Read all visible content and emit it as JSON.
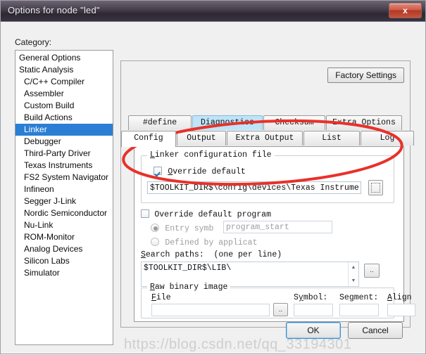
{
  "window": {
    "title": "Options for node \"led\"",
    "close_label": "x"
  },
  "category": {
    "label": "Category:",
    "items": [
      {
        "label": "General Options",
        "indent": false,
        "selected": false
      },
      {
        "label": "Static Analysis",
        "indent": false,
        "selected": false
      },
      {
        "label": "C/C++ Compiler",
        "indent": true,
        "selected": false
      },
      {
        "label": "Assembler",
        "indent": true,
        "selected": false
      },
      {
        "label": "Custom Build",
        "indent": true,
        "selected": false
      },
      {
        "label": "Build Actions",
        "indent": true,
        "selected": false
      },
      {
        "label": "Linker",
        "indent": true,
        "selected": true
      },
      {
        "label": "Debugger",
        "indent": true,
        "selected": false
      },
      {
        "label": "Third-Party Driver",
        "indent": true,
        "selected": false
      },
      {
        "label": "Texas Instruments",
        "indent": true,
        "selected": false
      },
      {
        "label": "FS2 System Navigator",
        "indent": true,
        "selected": false
      },
      {
        "label": "Infineon",
        "indent": true,
        "selected": false
      },
      {
        "label": "Segger J-Link",
        "indent": true,
        "selected": false
      },
      {
        "label": "Nordic Semiconductor",
        "indent": true,
        "selected": false
      },
      {
        "label": "Nu-Link",
        "indent": true,
        "selected": false
      },
      {
        "label": "ROM-Monitor",
        "indent": true,
        "selected": false
      },
      {
        "label": "Analog Devices",
        "indent": true,
        "selected": false
      },
      {
        "label": "Silicon Labs",
        "indent": true,
        "selected": false
      },
      {
        "label": "Simulator",
        "indent": true,
        "selected": false
      }
    ]
  },
  "panel": {
    "factory_settings_label": "Factory Settings"
  },
  "tabs": {
    "top_row": [
      {
        "label": "#define",
        "state": "normal",
        "width": 90
      },
      {
        "label": "Diagnostics",
        "state": "blue",
        "width": 100
      },
      {
        "label": "Checksum",
        "state": "normal",
        "width": 88
      },
      {
        "label": "Extra Options",
        "state": "normal",
        "width": 108
      }
    ],
    "bottom_row": [
      {
        "label": "Config",
        "state": "white",
        "width": 78
      },
      {
        "label": "Output",
        "state": "normal",
        "width": 70
      },
      {
        "label": "Extra Output",
        "state": "normal",
        "width": 108
      },
      {
        "label": "List",
        "state": "normal",
        "width": 80
      },
      {
        "label": "Log",
        "state": "normal",
        "width": 76
      }
    ]
  },
  "config": {
    "linker_group_legend": "Linker configuration file",
    "override_default": {
      "label": "Override default",
      "checked": true
    },
    "config_file_value": "$TOOLKIT_DIR$\\config\\devices\\Texas Instruments\\lnk",
    "browse_config_icon": "dotted-browse-icon",
    "override_default_program": {
      "label": "Override default program",
      "checked": false
    },
    "entry_symbol": {
      "label": "Entry symb",
      "value": "program_start",
      "selected": true
    },
    "defined_by_application": {
      "label": "Defined by applicat",
      "selected": false
    },
    "search_paths_label": "Search paths:  (one per line)",
    "search_paths_value": "$TOOLKIT_DIR$\\LIB\\",
    "search_paths_browse_label": "..",
    "raw_binary_group_legend": "Raw binary image",
    "raw_file_label": "File",
    "raw_file_value": "",
    "raw_file_browse_label": "..",
    "raw_symbol_label": "Symbol:",
    "raw_symbol_value": "",
    "raw_segment_label": "Segment:",
    "raw_segment_value": "",
    "raw_align_label": "Align",
    "raw_align_value": ""
  },
  "footer": {
    "ok_label": "OK",
    "cancel_label": "Cancel",
    "watermark": "https://blog.csdn.net/qq_33194301"
  },
  "colors": {
    "selection_blue": "#2a7fd4",
    "tab_active_blue": "#bfe4f8",
    "annotation_red": "#e8312a"
  }
}
